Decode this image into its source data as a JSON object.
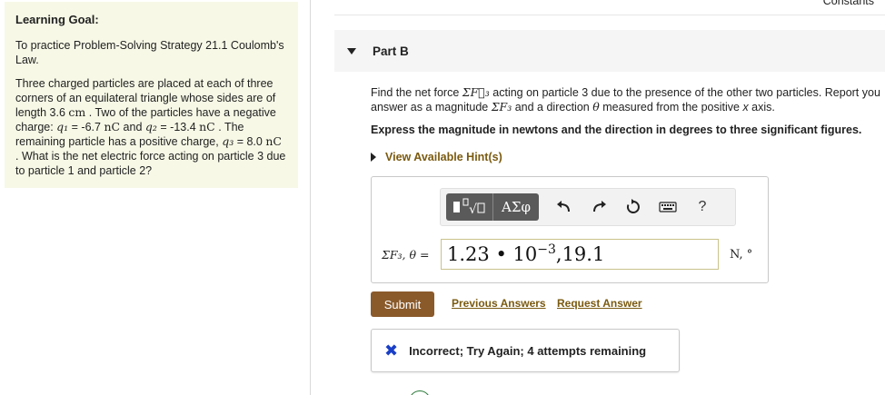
{
  "goal": {
    "heading": "Learning Goal:",
    "intro": "To practice Problem-Solving Strategy 21.1 Coulomb's Law.",
    "p1": "Three charged particles are placed at each of three corners of an equilateral triangle whose sides are of length 3.6 ",
    "unit_cm": "cm",
    "p2": " . Two of the particles have a negative charge: ",
    "q1": "q₁",
    "q1_val": " = -6.7 ",
    "nC1": "nC",
    "and": " and ",
    "q2": "q₂",
    "q2_val": " = -13.4 ",
    "nC2": "nC",
    "p3": " . The remaining particle has a positive charge, ",
    "q3": "q₃",
    "q3_val": " = 8.0 ",
    "nC3": "nC",
    "p4": " . What is the net electric force acting on particle 3 due to particle 1 and particle 2?"
  },
  "header": {
    "constants": "Constants"
  },
  "part": {
    "title": "Part B"
  },
  "question": {
    "a": "Find the net force ",
    "sym1": "ΣF⃗₃",
    "b": " acting on particle 3 due to the presence of the other two particles. Report you answer as a magnitude ",
    "sym2": "ΣF₃",
    "c": " and a direction ",
    "theta": "θ",
    "d": " measured from the positive ",
    "x": "x",
    "e": " axis."
  },
  "express": "Express the magnitude in newtons and the direction in degrees to three significant figures.",
  "hint": {
    "label": "View Available Hint(s)"
  },
  "toolbar": {
    "symbols": "ΑΣφ",
    "help": "?"
  },
  "answer": {
    "label": "ΣF₃, θ =",
    "mantissa": "1.23",
    "dot": " • ",
    "base": "10",
    "exponent": "−3",
    "rest": ",19.1",
    "units": "N, °"
  },
  "actions": {
    "submit": "Submit",
    "previous": "Previous Answers",
    "request": "Request Answer"
  },
  "feedback": {
    "icon": "✖",
    "text": "Incorrect; Try Again; 4 attempts remaining"
  },
  "colors": {
    "accent": "#8a5a2b",
    "link": "#7a5a10",
    "error": "#1a3fc7",
    "panel_bg": "#f7f8e6"
  }
}
